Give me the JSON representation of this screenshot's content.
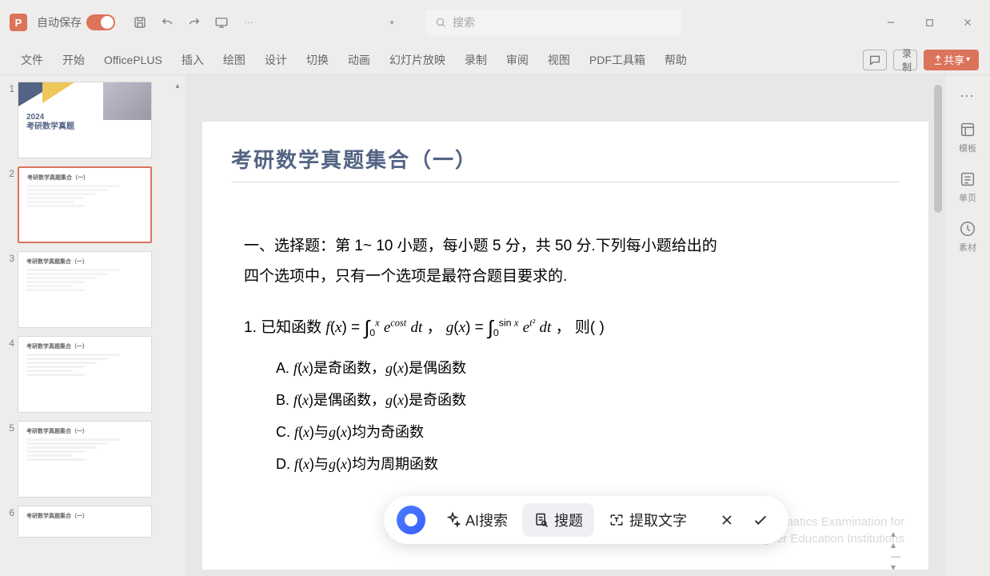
{
  "titlebar": {
    "autosave": "自动保存",
    "search_placeholder": "搜索"
  },
  "window": {
    "min": "—",
    "max": "☐",
    "close": "✕"
  },
  "ribbon": {
    "tabs": [
      "文件",
      "开始",
      "OfficePLUS",
      "插入",
      "绘图",
      "设计",
      "切换",
      "动画",
      "幻灯片放映",
      "录制",
      "审阅",
      "视图",
      "PDF工具箱",
      "帮助"
    ],
    "record": "录制",
    "share": "共享"
  },
  "thumbs": {
    "t1_year": "2024",
    "t1_title": "考研数学真题",
    "tcontent_title": "考研数学真题集合（一）"
  },
  "slide": {
    "title": "考研数学真题集合（一）",
    "watermark1": "Graduate Mathematics Examination for",
    "watermark2": "Higher Education Institutions"
  },
  "crop": {
    "section": "一、选择题：第 1~ 10 小题，每小题 5 分，共 50 分.下列每小题给出的四个选项中，只有一个选项是最符合题目要求的.",
    "q1_pre": "1.  已知函数 ",
    "q1_post": " ，  则(          )",
    "optA_label": "A.  ",
    "optA": "是奇函数，",
    "optA2": "是偶函数",
    "optB_label": "B.  ",
    "optB": "是偶函数，",
    "optB2": "是奇函数",
    "optC_label": "C.  ",
    "optC": "均为奇函数",
    "optD_label": "D.  ",
    "optD": "均为周期函数"
  },
  "rail": {
    "tpl": "模板",
    "single": "单页",
    "material": "素材"
  },
  "action": {
    "ai_search": "AI搜索",
    "search_q": "搜题",
    "extract": "提取文字"
  }
}
